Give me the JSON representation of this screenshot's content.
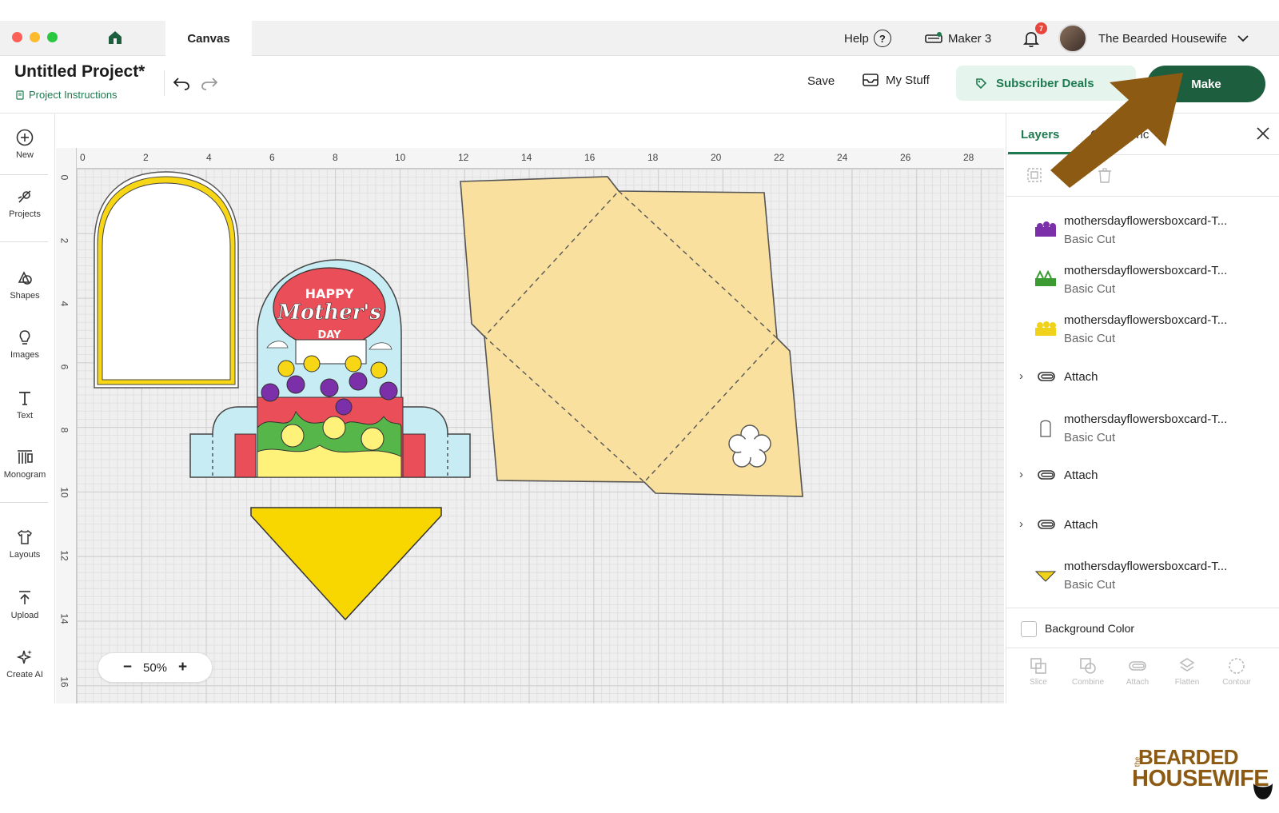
{
  "titlebar": {
    "tab": "Canvas",
    "help": "Help",
    "machine": "Maker 3",
    "notif_count": "7",
    "user": "The Bearded Housewife"
  },
  "header": {
    "project_title": "Untitled Project*",
    "project_instructions": "Project Instructions",
    "save": "Save",
    "my_stuff": "My Stuff",
    "subscriber": "Subscriber Deals",
    "make": "Make"
  },
  "lefttools": [
    {
      "label": "New",
      "icon": "plus-circle-icon"
    },
    {
      "label": "Projects",
      "icon": "projects-icon"
    },
    {
      "label": "Shapes",
      "icon": "shapes-icon"
    },
    {
      "label": "Images",
      "icon": "lightbulb-icon"
    },
    {
      "label": "Text",
      "icon": "text-icon"
    },
    {
      "label": "Monogram",
      "icon": "monogram-icon"
    },
    {
      "label": "Layouts",
      "icon": "shirt-icon"
    },
    {
      "label": "Upload",
      "icon": "upload-icon"
    },
    {
      "label": "Create AI",
      "icon": "sparkle-icon"
    }
  ],
  "rulers": {
    "top": [
      "0",
      "2",
      "4",
      "6",
      "8",
      "10",
      "12",
      "14",
      "16",
      "18",
      "20",
      "22",
      "24",
      "26",
      "28"
    ],
    "left": [
      "0",
      "2",
      "4",
      "6",
      "8",
      "10",
      "12",
      "14",
      "16"
    ]
  },
  "canvas_art": {
    "card_text_top": "HAPPY",
    "card_text_mid": "Mother's",
    "card_text_bot": "DAY"
  },
  "zoom": {
    "minus": "−",
    "value": "50%",
    "plus": "+"
  },
  "panel": {
    "tab_layers": "Layers",
    "tab_colors": "Color Sync",
    "layers": [
      {
        "type": "layer",
        "name": "mothersdayflowersboxcard-T...",
        "op": "Basic Cut",
        "thumb_color": "#7b2fa8"
      },
      {
        "type": "layer",
        "name": "mothersdayflowersboxcard-T...",
        "op": "Basic Cut",
        "thumb_color": "#3c9a33"
      },
      {
        "type": "layer",
        "name": "mothersdayflowersboxcard-T...",
        "op": "Basic Cut",
        "thumb_color": "#f0d21a"
      },
      {
        "type": "attach",
        "name": "Attach"
      },
      {
        "type": "layer",
        "name": "mothersdayflowersboxcard-T...",
        "op": "Basic Cut",
        "thumb_color": "#ffffff"
      },
      {
        "type": "attach",
        "name": "Attach"
      },
      {
        "type": "attach",
        "name": "Attach"
      },
      {
        "type": "layer",
        "name": "mothersdayflowersboxcard-T...",
        "op": "Basic Cut",
        "thumb_color": "#f0d21a"
      }
    ],
    "bg_color": "Background Color",
    "bottom_tools": [
      "Slice",
      "Combine",
      "Attach",
      "Flatten",
      "Contour"
    ]
  },
  "watermark": {
    "the": "the",
    "top": "BEARDED",
    "bottom": "HOUSEWIFE"
  },
  "colors": {
    "brand_green": "#1d5e3e",
    "accent_green": "#1e7a4f",
    "arrow_brown": "#8c5a12"
  }
}
